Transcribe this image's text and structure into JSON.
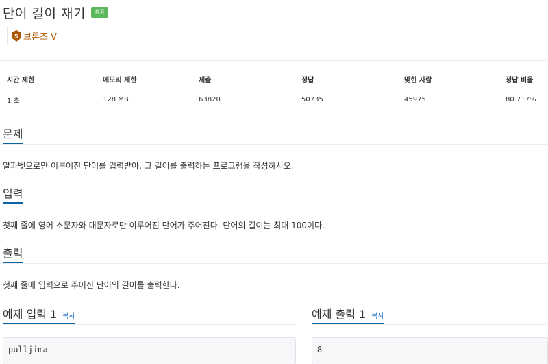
{
  "problem": {
    "title": "단어 길이 재기",
    "status_badge": "성공",
    "tier_label": "브론즈 V",
    "tier_number": "5",
    "tier_color": "#ad5600"
  },
  "info_table": {
    "headers": [
      "시간 제한",
      "메모리 제한",
      "제출",
      "정답",
      "맞힌 사람",
      "정답 비율"
    ],
    "values": [
      "1 초",
      "128 MB",
      "63820",
      "50735",
      "45975",
      "80.717%"
    ]
  },
  "sections": {
    "problem": {
      "heading": "문제",
      "text": "알파벳으로만 이루어진 단어를 입력받아, 그 길이를 출력하는 프로그램을 작성하시오."
    },
    "input": {
      "heading": "입력",
      "text": "첫째 줄에 영어 소문자와 대문자로만 이루어진 단어가 주어진다. 단어의 길이는 최대 100이다."
    },
    "output": {
      "heading": "출력",
      "text": "첫째 줄에 입력으로 주어진 단어의 길이를 출력한다."
    }
  },
  "samples": {
    "input": {
      "heading": "예제 입력 1",
      "copy_label": "복사",
      "content": "pulljima"
    },
    "output": {
      "heading": "예제 출력 1",
      "copy_label": "복사",
      "content": "8"
    }
  },
  "colors": {
    "badge": "#5cb85c",
    "accent": "#0b62a4",
    "link": "#2a76c6"
  }
}
